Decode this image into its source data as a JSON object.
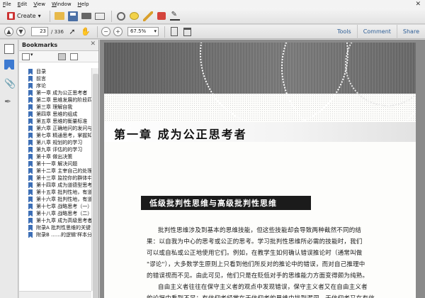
{
  "menu": [
    {
      "u": "F",
      "rest": "ile"
    },
    {
      "u": "E",
      "rest": "dit"
    },
    {
      "u": "V",
      "rest": "iew"
    },
    {
      "u": "W",
      "rest": "indow"
    },
    {
      "u": "H",
      "rest": "elp"
    }
  ],
  "toolbar": {
    "create_label": "Create"
  },
  "nav": {
    "current_page": "23",
    "total_pages": "/ 336",
    "zoom": "67.5%"
  },
  "right_links": [
    "Tools",
    "Comment",
    "Share"
  ],
  "bookmarks": {
    "title": "Bookmarks",
    "items": [
      "目录",
      "前言",
      "序论",
      "第一章 成为公正思考者",
      "第二章 思维发展的阶段四",
      "第三章 理解自我",
      "第四章 思维的组成",
      "第五章 思维的衡量标准",
      "第六章 正确地问的发问与自",
      "第七章 精通思考，掌握知",
      "第八章 规划的的学习",
      "第九章 评估的的学习",
      "第十章 做出决策",
      "第十一章 解决问题",
      "第十二章 主宰自己的处理",
      "第十三章 监控你的群体中",
      "第十四章 成为道德型思考",
      "第十五章 批判性地，有道",
      "第十六章 批判性地，有道",
      "第十七章 战略思考（一）",
      "第十八章 战略思考（二）",
      "第十九章 成为高级思考者",
      "附录A 批判性思维的关键",
      "附录B ……的逻辑'样本分析"
    ]
  },
  "document": {
    "chapter_title": "第一章   成为公正思考者",
    "section_title": "低级批判性思维与高级批判性思维",
    "paragraph_lines": [
      "批判性思维涉及到基本的思维技能，但这些技能却会导致两种截然不同的结",
      "果：以自我为中心的思考或公正的思考。学习批判性思维所必需的技能时，我们",
      "可以或自私或公正地使用它们。例如，在教学生如何确认错误推论时（通常叫做",
      "\"谬论\"），大多数学生原则上只看到他们所反对的推论中的错误，而对自己推理中",
      "的错误视而不见。由此可见，他们只是在贬低对手的思维能力方面变得颇为纯熟。",
      "自由主义者往往在保守主义者的观点中发现错误，保守主义者又在自由主义者",
      "的论据中看到不足；有信仰者经常在无信仰者的思维中找到漏洞，无信仰者又在有信"
    ]
  }
}
